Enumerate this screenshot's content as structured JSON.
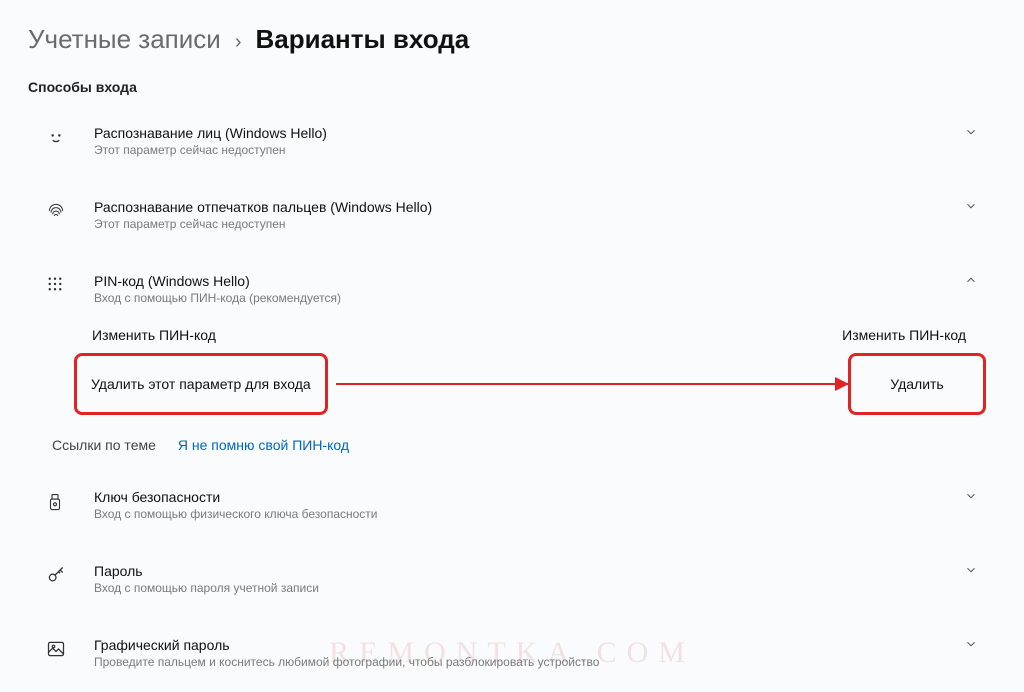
{
  "breadcrumb": {
    "parent": "Учетные записи",
    "current": "Варианты входа"
  },
  "section_heading": "Способы входа",
  "options": {
    "face": {
      "title": "Распознавание лиц (Windows Hello)",
      "sub": "Этот параметр сейчас недоступен"
    },
    "fingerprint": {
      "title": "Распознавание отпечатков пальцев (Windows Hello)",
      "sub": "Этот параметр сейчас недоступен"
    },
    "pin": {
      "title": "PIN-код (Windows Hello)",
      "sub": "Вход с помощью ПИН-кода (рекомендуется)",
      "change_left": "Изменить ПИН-код",
      "change_right": "Изменить ПИН-код",
      "remove_option_label": "Удалить этот параметр для входа",
      "remove_button": "Удалить",
      "links_label": "Ссылки по теме",
      "forgot_link": "Я не помню свой ПИН-код"
    },
    "seckey": {
      "title": "Ключ безопасности",
      "sub": "Вход с помощью физического ключа безопасности"
    },
    "password": {
      "title": "Пароль",
      "sub": "Вход с помощью пароля учетной записи"
    },
    "picture": {
      "title": "Графический пароль",
      "sub": "Проведите пальцем и коснитесь любимой фотографии, чтобы разблокировать устройство"
    }
  },
  "watermark": "REMONTKA.COM"
}
